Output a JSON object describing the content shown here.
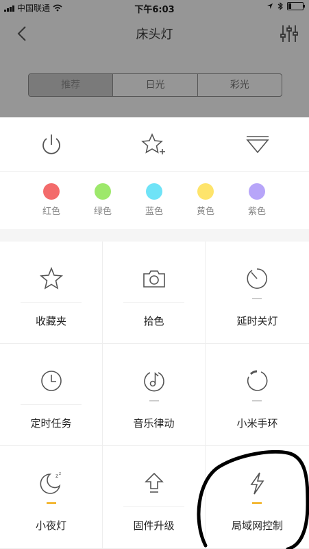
{
  "status_bar": {
    "carrier": "中国联通",
    "time": "下午6:03"
  },
  "nav": {
    "title": "床头灯",
    "back_icon": "chevron-left-icon",
    "settings_icon": "sliders-icon"
  },
  "segments": [
    "推荐",
    "日光",
    "彩光"
  ],
  "quick_actions": [
    {
      "name": "power",
      "icon": "power-icon"
    },
    {
      "name": "add-favorite",
      "icon": "star-plus-icon"
    },
    {
      "name": "collapse",
      "icon": "triangle-down-icon"
    }
  ],
  "colors": [
    {
      "label": "红色",
      "hex": "#f36b6b"
    },
    {
      "label": "绿色",
      "hex": "#9de86b"
    },
    {
      "label": "蓝色",
      "hex": "#6fe3f7"
    },
    {
      "label": "黄色",
      "hex": "#fee46b"
    },
    {
      "label": "紫色",
      "hex": "#b7a5f9"
    }
  ],
  "features": [
    {
      "label": "收藏夹",
      "icon": "star-icon"
    },
    {
      "label": "拾色",
      "icon": "camera-icon"
    },
    {
      "label": "延时关灯",
      "icon": "timer-icon"
    },
    {
      "label": "定时任务",
      "icon": "clock-icon"
    },
    {
      "label": "音乐律动",
      "icon": "music-icon"
    },
    {
      "label": "小米手环",
      "icon": "band-icon"
    },
    {
      "label": "小夜灯",
      "icon": "moon-icon"
    },
    {
      "label": "固件升级",
      "icon": "upgrade-arrow-icon"
    },
    {
      "label": "局域网控制",
      "icon": "lightning-icon"
    }
  ],
  "accent_color": "#f0a500"
}
